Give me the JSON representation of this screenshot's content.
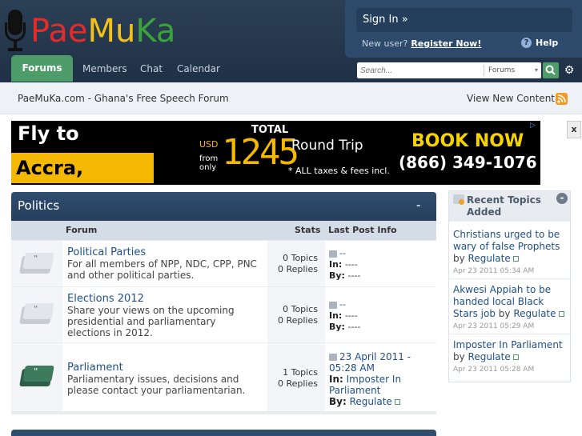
{
  "site": {
    "logo_text_1": "Pae",
    "logo_text_2": "Mu",
    "logo_text_3": "Ka"
  },
  "user": {
    "signin_label": "Sign In »",
    "new_user_label": "New user?",
    "register_label": "Register Now!",
    "help_label": "Help"
  },
  "nav": {
    "tabs": [
      "Forums",
      "Members",
      "Chat",
      "Calendar"
    ]
  },
  "search": {
    "placeholder": "Search...",
    "scope": "Forums"
  },
  "breadcrumb": {
    "text": "PaeMuKa.com - Ghana's Free Speech Forum",
    "view_new": "View New Content"
  },
  "ad": {
    "fly_to": "Fly to",
    "destination": "Accra, Ghana",
    "total": "TOTAL",
    "usd": "USD",
    "from": "from",
    "only": "only",
    "price": "1245",
    "round_trip": "Round Trip",
    "taxes": "* ALL taxes & fees incl.",
    "book": "BOOK NOW",
    "phone": "(866) 349-1076",
    "close": "x"
  },
  "category": {
    "title": "Politics",
    "collapse": "-",
    "col_forum": "Forum",
    "col_stats": "Stats",
    "col_last": "Last Post Info",
    "forums": [
      {
        "name": "Political Parties",
        "desc": "For all members of NPP, NDC, CPP, PNC and other political parties.",
        "topics": "0 Topics",
        "replies": "0 Replies",
        "last_title": "--",
        "last_in_label": "In:",
        "last_in": "----",
        "last_by_label": "By:",
        "last_by": "----"
      },
      {
        "name": "Elections 2012",
        "desc": "Share your views on the upcoming presidential and parliamentary elections in 2012.",
        "topics": "0 Topics",
        "replies": "0 Replies",
        "last_title": "--",
        "last_in_label": "In:",
        "last_in": "----",
        "last_by_label": "By:",
        "last_by": "----"
      },
      {
        "name": "Parliament",
        "desc": "Parliamentary issues, decisions and please contact your parliamentarian.",
        "topics": "1 Topics",
        "replies": "0 Replies",
        "last_title": "23 April 2011 - 05:28 AM",
        "last_in_label": "In:",
        "last_in": "Imposter In Parliament",
        "last_by_label": "By:",
        "last_by": "Regulate"
      }
    ]
  },
  "sidebar": {
    "title": "Recent Topics Added",
    "minimize": "-",
    "by_label": "by",
    "topics": [
      {
        "title": "Christians urged to be wary of false Prophets",
        "user": "Regulate",
        "date": "Apr 23 2011 05:34 AM"
      },
      {
        "title": "Akwesi Appiah to be handed local Black Stars job",
        "user": "Regulate",
        "date": "Apr 23 2011 05:29 AM"
      },
      {
        "title": "Imposter In Parliament",
        "user": "Regulate",
        "date": "Apr 23 2011 05:28 AM"
      }
    ]
  },
  "colors": {
    "header_bg": "#1f3147",
    "accent_green": "#4f9c6b",
    "link_blue": "#1f4f8a"
  }
}
